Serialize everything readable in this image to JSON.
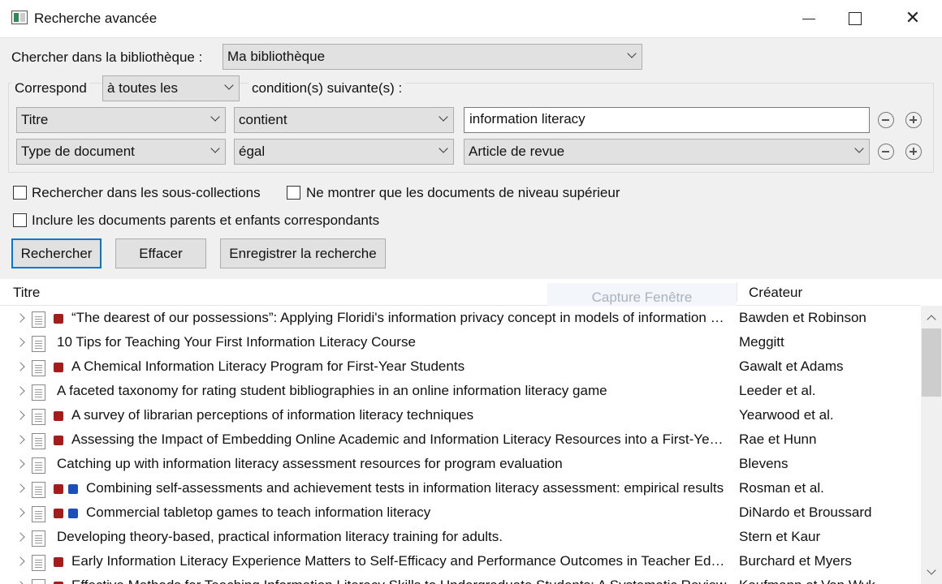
{
  "window": {
    "title": "Recherche avancée"
  },
  "library": {
    "label": "Chercher dans la bibliothèque :",
    "value": "Ma bibliothèque"
  },
  "match": {
    "label": "Correspond",
    "value": "à toutes les",
    "suffix": "condition(s) suivante(s) :"
  },
  "conditions": [
    {
      "field": "Titre",
      "operator": "contient",
      "value": "information literacy"
    },
    {
      "field": "Type de document",
      "operator": "égal",
      "value": "Article de revue"
    }
  ],
  "options": {
    "subcollections": "Rechercher dans les sous-collections",
    "top_level": "Ne montrer que les documents de niveau supérieur",
    "include_parents": "Inclure les documents parents et enfants correspondants"
  },
  "buttons": {
    "search": "Rechercher",
    "clear": "Effacer",
    "save": "Enregistrer la recherche"
  },
  "columns": {
    "title": "Titre",
    "creator": "Créateur"
  },
  "watermark": "Capture Fenêtre",
  "rows": [
    {
      "tags": [
        "red"
      ],
      "title": "“The dearest of our possessions”: Applying Floridi's information privacy concept in models of information behavior",
      "creator": "Bawden et Robinson"
    },
    {
      "tags": [],
      "title": "10 Tips for Teaching Your First Information Literacy Course",
      "creator": "Meggitt"
    },
    {
      "tags": [
        "red"
      ],
      "title": "A Chemical Information Literacy Program for First-Year Students",
      "creator": "Gawalt et Adams"
    },
    {
      "tags": [],
      "title": "A faceted taxonomy for rating student bibliographies in an online information literacy game",
      "creator": "Leeder et al."
    },
    {
      "tags": [
        "red"
      ],
      "title": "A survey of librarian perceptions of information literacy techniques",
      "creator": "Yearwood et al."
    },
    {
      "tags": [
        "red"
      ],
      "title": "Assessing the Impact of Embedding Online Academic and Information Literacy Resources into a First-Year Course",
      "creator": "Rae et Hunn"
    },
    {
      "tags": [],
      "title": "Catching up with information literacy assessment resources for program evaluation",
      "creator": "Blevens"
    },
    {
      "tags": [
        "red",
        "blue"
      ],
      "title": "Combining self-assessments and achievement tests in information literacy assessment: empirical results",
      "creator": "Rosman et al."
    },
    {
      "tags": [
        "red",
        "blue"
      ],
      "title": "Commercial tabletop games to teach information literacy",
      "creator": "DiNardo et Broussard"
    },
    {
      "tags": [],
      "title": "Developing theory-based, practical information literacy training for adults.",
      "creator": "Stern et Kaur"
    },
    {
      "tags": [
        "red"
      ],
      "title": "Early Information Literacy Experience Matters to Self-Efficacy and Performance Outcomes in Teacher Education",
      "creator": "Burchard et Myers"
    },
    {
      "tags": [
        "red"
      ],
      "title": "Effective Methods for Teaching Information Literacy Skills to Undergraduate Students: A Systematic Review",
      "creator": "Kaufmann et Van Wyk"
    }
  ]
}
